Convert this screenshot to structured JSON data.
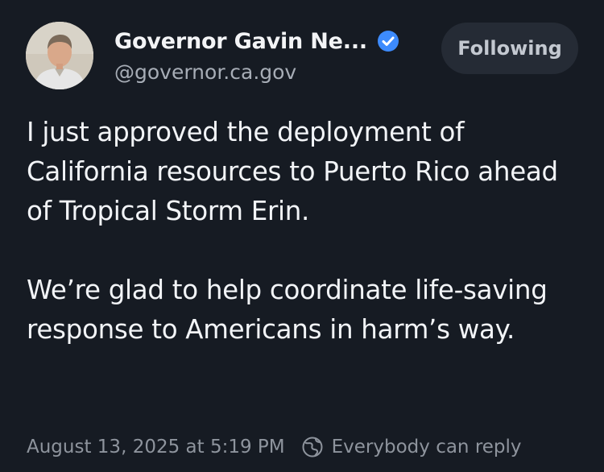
{
  "post": {
    "author": {
      "display_name": "Governor Gavin Ne...",
      "handle": "@governor.ca.gov",
      "verified": true,
      "verified_icon": "verified-check-icon",
      "avatar_icon": "avatar"
    },
    "follow_button": {
      "label": "Following"
    },
    "body": {
      "paragraphs": [
        "I just approved the deployment of California resources to Puerto Rico ahead of Tropical Storm Erin.",
        "We’re glad to help coordinate life-saving response to Americans in harm’s way."
      ]
    },
    "meta": {
      "timestamp": "August 13, 2025 at 5:19 PM",
      "reply_setting": "Everybody can reply",
      "reply_icon": "globe-icon"
    }
  },
  "colors": {
    "background": "#161b23",
    "primary_text": "#f2f4f7",
    "secondary_text": "#a7adb6",
    "verified_blue": "#3d8bfd",
    "button_background": "#252b35"
  }
}
